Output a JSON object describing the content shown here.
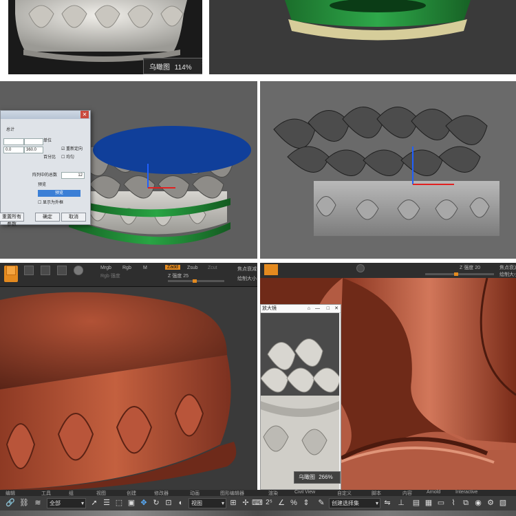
{
  "panel_top": {
    "zoom_badge": {
      "label": "乌瞰图",
      "value": "114%"
    }
  },
  "panel_dialog": {
    "title": "",
    "labels": [
      "总计",
      "单位",
      "重新定向",
      "百分比",
      "均匀",
      "阵列中的总数",
      "预览",
      "显示为外框"
    ],
    "fields": [
      "0.0",
      "360.0",
      "12"
    ],
    "preview_button": "预览",
    "reset_button": "重置所有参数",
    "ok_button": "确定",
    "cancel_button": "取消"
  },
  "panel_zbrush": {
    "tools": [
      "Lightbox",
      "PolyPaint",
      "Edit",
      "Move",
      "Scale",
      "Rotate"
    ],
    "mrgb": "Mrgb",
    "rgb": "Rgb",
    "m": "M",
    "zadd": "Zadd",
    "zsub": "Zsub",
    "zcut": "Zcut",
    "rgb_intensity": "Rgb 强度",
    "z_intensity_label": "Z 强度",
    "z_intensity_value": "25",
    "focal_label": "焦点衰减",
    "draw_size_label": "绘制大小"
  },
  "panel_zbrush2": {
    "z_intensity_label": "Z 强度",
    "z_intensity_value": "20",
    "focal_label": "焦点衰减",
    "draw_size_label": "绘制大小",
    "mag_window_title": "放大镜",
    "mag_badge": {
      "label": "乌瞰图",
      "value": "266%"
    }
  },
  "bottom_toolbar": {
    "menu_items": [
      "编辑",
      "工具",
      "组",
      "视图",
      "创建",
      "修改器",
      "动画",
      "图形编辑器",
      "渲染",
      "Civil View",
      "自定义",
      "脚本",
      "内容",
      "Arnold",
      "Interactive"
    ],
    "filter_dropdown": "全部",
    "view_dropdown": "视图",
    "selection_set": "创建选择集"
  },
  "colors": {
    "accent_orange": "#e48a1f",
    "max_bg": "#3d3d3d",
    "zbrush_clay": "#a4472e",
    "lotus_white": "#d9d6cf",
    "base_green": "#1f8a36",
    "top_blue": "#123f9c"
  }
}
